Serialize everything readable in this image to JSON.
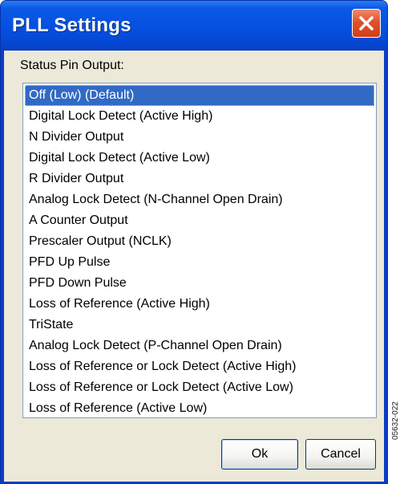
{
  "window": {
    "title": "PLL Settings",
    "close_icon": "close-icon"
  },
  "status": {
    "label": "Status Pin Output:",
    "selected_index": 0,
    "items": [
      "Off (Low) (Default)",
      "Digital Lock Detect (Active High)",
      "N Divider Output",
      "Digital Lock Detect (Active Low)",
      "R Divider Output",
      "Analog Lock Detect (N-Channel Open Drain)",
      "A Counter Output",
      "Prescaler Output (NCLK)",
      "PFD Up Pulse",
      "PFD Down Pulse",
      "Loss of Reference (Active High)",
      "TriState",
      "Analog Lock Detect (P-Channel Open Drain)",
      "Loss of Reference or Lock Detect (Active High)",
      "Loss of Reference or Lock Detect (Active Low)",
      "Loss of Reference (Active Low)"
    ]
  },
  "buttons": {
    "ok": "Ok",
    "cancel": "Cancel"
  },
  "figure_code": "05632-022",
  "colors": {
    "titlebar": "#0651e0",
    "selection": "#316ac5",
    "dialog_face": "#ece9d8",
    "close_button": "#e0502a"
  }
}
